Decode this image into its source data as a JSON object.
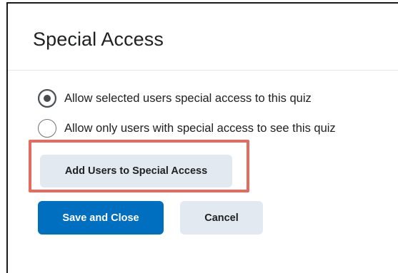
{
  "dialog": {
    "title": "Special Access"
  },
  "access_options": [
    {
      "label": "Allow selected users special access to this quiz",
      "selected": true
    },
    {
      "label": "Allow only users with special access to see this quiz",
      "selected": false
    }
  ],
  "buttons": {
    "add_users_label": "Add Users to Special Access",
    "save_label": "Save and Close",
    "cancel_label": "Cancel"
  },
  "colors": {
    "primary": "#006fbf",
    "secondary": "#e3e9f1",
    "highlight": "#e36b5f"
  }
}
